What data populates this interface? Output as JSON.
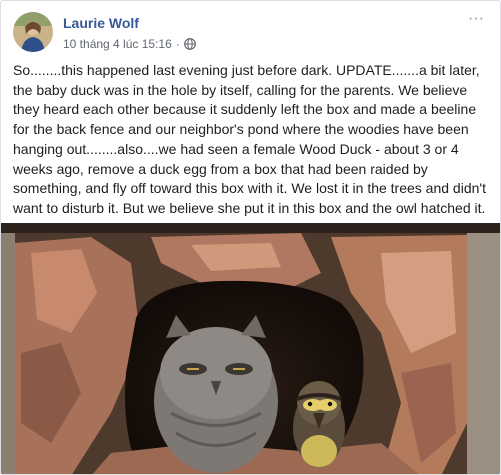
{
  "post": {
    "author": "Laurie Wolf",
    "timestamp": "10 tháng 4 lúc 15:16",
    "separator": "·",
    "privacy_icon": "globe-icon",
    "more_icon": "more-options-icon",
    "more_label": "···",
    "text": "So........this happened last evening just before dark. UPDATE.......a bit later, the baby duck was in the hole by itself, calling for the parents. We believe they heard each other because it suddenly left the box and made a beeline for the back fence and our neighbor's pond where the woodies have been hanging out........also....we had seen a female Wood Duck - about 3 or 4 weeks ago, remove a duck egg from a box that had been raided by something, and fly off toward this box with it. We lost it in the trees and didn't want to disturb it. But we believe she put it in this box and the owl hatched it."
  },
  "colors": {
    "author_link": "#385898",
    "meta_text": "#616770",
    "body_text": "#1c1e21",
    "border": "#dddfe2"
  }
}
